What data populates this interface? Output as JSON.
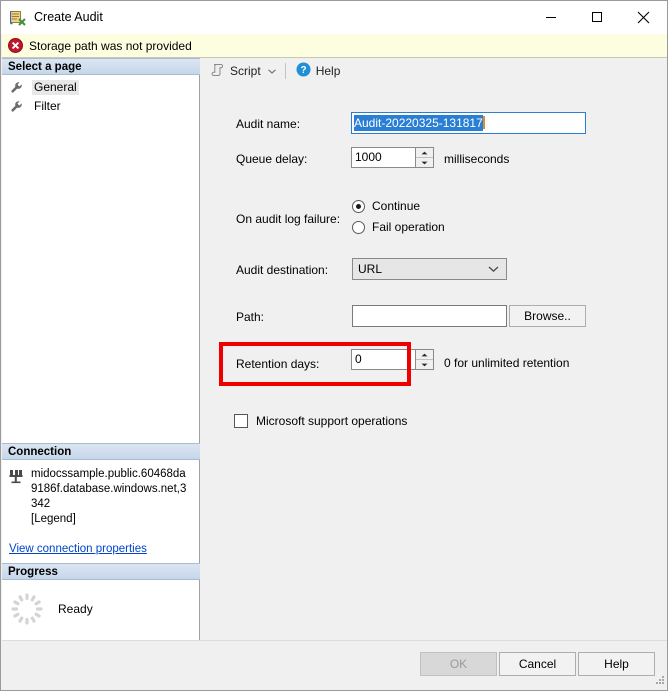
{
  "window": {
    "title": "Create Audit",
    "icon": "create-audit-icon",
    "controls": {
      "minimize": "minimize-icon",
      "maximize": "maximize-icon",
      "close": "close-icon"
    }
  },
  "error_banner": {
    "icon": "error-icon",
    "message": "Storage path was not provided"
  },
  "left_panel": {
    "select_page": {
      "header": "Select a page",
      "items": [
        {
          "label": "General",
          "icon": "wrench-icon",
          "selected": true
        },
        {
          "label": "Filter",
          "icon": "wrench-icon",
          "selected": false
        }
      ]
    },
    "connection": {
      "header": "Connection",
      "icon": "server-connection-icon",
      "server": "midocssample.public.60468da9186f.database.windows.net,3342",
      "user": "[Legend]",
      "link": "View connection properties"
    },
    "progress": {
      "header": "Progress",
      "icon": "spinner-icon",
      "status": "Ready"
    }
  },
  "toolbar": {
    "script_label": "Script",
    "script_icon": "script-icon",
    "script_caret": "chevron-down-icon",
    "help_label": "Help",
    "help_icon": "help-question-icon"
  },
  "form": {
    "audit_name": {
      "label": "Audit name:",
      "value": "Audit-20220325-131817",
      "selected": true,
      "focused": true
    },
    "queue_delay": {
      "label": "Queue delay:",
      "value": "1000",
      "unit": "milliseconds"
    },
    "on_audit_log_failure": {
      "label": "On audit log failure:",
      "options": [
        {
          "label": "Continue",
          "checked": true
        },
        {
          "label": "Fail operation",
          "checked": false
        }
      ]
    },
    "audit_destination": {
      "label": "Audit destination:",
      "value": "URL",
      "caret": "chevron-down-icon"
    },
    "path": {
      "label": "Path:",
      "value": "",
      "browse_label": "Browse.."
    },
    "retention_days": {
      "label": "Retention days:",
      "value": "0",
      "hint": "0 for unlimited retention"
    },
    "microsoft_support_operations": {
      "label": "Microsoft support operations",
      "checked": false,
      "highlighted": true
    }
  },
  "footer": {
    "ok_label": "OK",
    "ok_disabled": true,
    "cancel_label": "Cancel",
    "help_label": "Help",
    "grip": "resize-grip-icon"
  },
  "colors": {
    "accent": "#2a7fd4",
    "annotation": "#ef0000",
    "banner_bg": "#fdfddf",
    "panel_bg": "#f0f0f0"
  }
}
